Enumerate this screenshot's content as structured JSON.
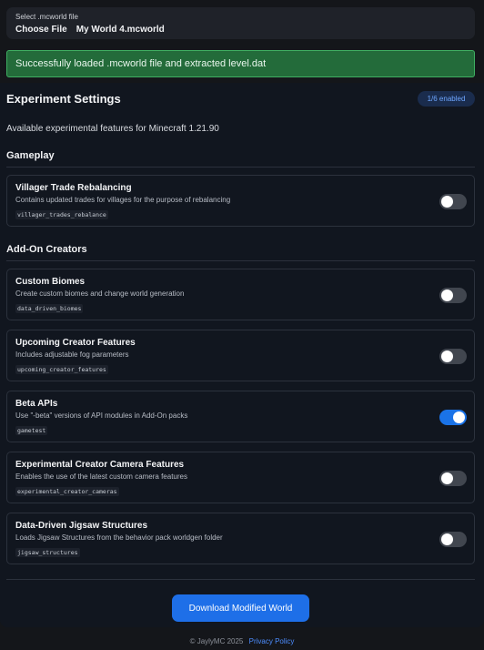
{
  "file_input": {
    "label": "Select .mcworld file",
    "button_label": "Choose File",
    "file_name": "My World 4.mcworld"
  },
  "alert": {
    "message": "Successfully loaded .mcworld file and extracted level.dat",
    "color": "#236b3a"
  },
  "panel": {
    "title": "Experiment Settings",
    "badge": "1/6 enabled",
    "subtitle": "Available experimental features for Minecraft 1.21.90"
  },
  "sections": [
    {
      "title": "Gameplay",
      "items": [
        {
          "title": "Villager Trade Rebalancing",
          "description": "Contains updated trades for villages for the purpose of rebalancing",
          "code": "villager_trades_rebalance",
          "enabled": false
        }
      ]
    },
    {
      "title": "Add-On Creators",
      "items": [
        {
          "title": "Custom Biomes",
          "description": "Create custom biomes and change world generation",
          "code": "data_driven_biomes",
          "enabled": false
        },
        {
          "title": "Upcoming Creator Features",
          "description": "Includes adjustable fog parameters",
          "code": "upcoming_creator_features",
          "enabled": false
        },
        {
          "title": "Beta APIs",
          "description": "Use \"-beta\" versions of API modules in Add-On packs",
          "code": "gametest",
          "enabled": true
        },
        {
          "title": "Experimental Creator Camera Features",
          "description": "Enables the use of the latest custom camera features",
          "code": "experimental_creator_cameras",
          "enabled": false
        },
        {
          "title": "Data-Driven Jigsaw Structures",
          "description": "Loads Jigsaw Structures from the behavior pack worldgen folder",
          "code": "jigsaw_structures",
          "enabled": false
        }
      ]
    }
  ],
  "download_button": "Download Modified World",
  "footer": {
    "copyright": "© JaylyMC 2025",
    "link": "Privacy Policy"
  },
  "colors": {
    "accent": "#1e6fe8",
    "toggle_off": "#41464f",
    "toggle_on": "#1a73e8"
  }
}
